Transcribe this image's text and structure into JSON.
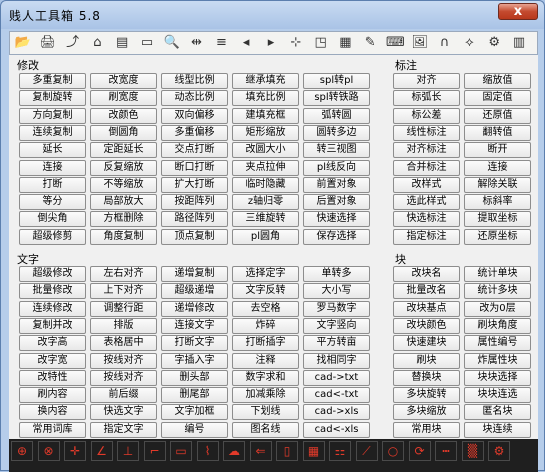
{
  "window": {
    "title": "贱人工具箱 5.8",
    "close_symbol": "x"
  },
  "toolbar": {
    "icons": [
      "folder-open-icon",
      "print-icon",
      "export-icon",
      "home-icon",
      "printer-icon",
      "window-icon",
      "zoom-icon",
      "dimension-icon",
      "layer-stack-icon",
      "arrow-left-icon",
      "arrow-right-icon",
      "move-icon",
      "frame-icon",
      "color-grid-icon",
      "edit-icon",
      "keyboard-icon",
      "image-icon",
      "magnet-icon",
      "snap-icon",
      "gears-icon",
      "calculator-icon"
    ],
    "glyphs": [
      "📂",
      "🖨",
      "⤴",
      "⌂",
      "▤",
      "▭",
      "🔍",
      "⇹",
      "≡",
      "◂",
      "▸",
      "⊹",
      "◳",
      "▦",
      "✎",
      "⌨",
      "🖼",
      "∩",
      "⟡",
      "⚙",
      "▥"
    ]
  },
  "sections": {
    "modify": "修改",
    "annotate": "标注",
    "text": "文字",
    "block": "块"
  },
  "modify_buttons": [
    [
      "多重复制",
      "改宽度",
      "线型比例",
      "继承填充",
      "spl转pl"
    ],
    [
      "复制旋转",
      "刷宽度",
      "动态比例",
      "填充比例",
      "spl转铁路"
    ],
    [
      "方向复制",
      "改颜色",
      "双向偏移",
      "建填充框",
      "弧转圆"
    ],
    [
      "连续复制",
      "倒圆角",
      "多重偏移",
      "矩形缩放",
      "圆转多边"
    ],
    [
      "延长",
      "定距延长",
      "交点打断",
      "改圆大小",
      "转三视图"
    ],
    [
      "连接",
      "反复缩放",
      "断口打断",
      "夹点拉伸",
      "pl线反向"
    ],
    [
      "打断",
      "不等缩放",
      "扩大打断",
      "临时隐藏",
      "前置对象"
    ],
    [
      "等分",
      "局部放大",
      "按距阵列",
      "z轴归零",
      "后置对象"
    ],
    [
      "倒尖角",
      "方框删除",
      "路径阵列",
      "三维旋转",
      "快速选择"
    ],
    [
      "超级修剪",
      "角度复制",
      "顶点复制",
      "pl圆角",
      "保存选择"
    ]
  ],
  "annotate_buttons": [
    [
      "对齐",
      "缩放值"
    ],
    [
      "标弧长",
      "固定值"
    ],
    [
      "标公差",
      "还原值"
    ],
    [
      "线性标注",
      "翻转值"
    ],
    [
      "对齐标注",
      "断开"
    ],
    [
      "合并标注",
      "连接"
    ],
    [
      "改样式",
      "解除关联"
    ],
    [
      "选此样式",
      "标斜率"
    ],
    [
      "快选标注",
      "提取坐标"
    ],
    [
      "指定标注",
      "还原坐标"
    ]
  ],
  "text_buttons": [
    [
      "超级修改",
      "左右对齐",
      "递增复制",
      "选择定字",
      "单转多"
    ],
    [
      "批量修改",
      "上下对齐",
      "超级递增",
      "文字反转",
      "大小写"
    ],
    [
      "连续修改",
      "调整行距",
      "递增修改",
      "去空格",
      "罗马数字"
    ],
    [
      "复制并改",
      "排版",
      "连接文字",
      "炸碎",
      "文字竖向"
    ],
    [
      "改字高",
      "表格居中",
      "打断文字",
      "打断插字",
      "平方转亩"
    ],
    [
      "改字宽",
      "按线对齐",
      "字插入字",
      "注释",
      "找相同字"
    ],
    [
      "改特性",
      "按线对齐",
      "删头部",
      "数字求和",
      "cad->txt"
    ],
    [
      "刷内容",
      "前后缀",
      "删尾部",
      "加减乘除",
      "cad<-txt"
    ],
    [
      "换内容",
      "快选文字",
      "文字加框",
      "下划线",
      "cad->xls"
    ],
    [
      "常用词库",
      "指定文字",
      "编号",
      "图名线",
      "cad<-xls"
    ]
  ],
  "block_buttons": [
    [
      "改块名",
      "统计单块"
    ],
    [
      "批量改名",
      "统计多块"
    ],
    [
      "改块基点",
      "改为0层"
    ],
    [
      "改块颜色",
      "刷块角度"
    ],
    [
      "快速建块",
      "属性编号"
    ],
    [
      "刷块",
      "炸属性块"
    ],
    [
      "替换块",
      "块块选择"
    ],
    [
      "多块旋转",
      "块块连选"
    ],
    [
      "多块缩放",
      "匿名块"
    ],
    [
      "常用块",
      "块连续"
    ]
  ],
  "bottom_bar": {
    "icons": [
      "crosshair-icon",
      "circle-cross-icon",
      "point-icon",
      "angle-icon",
      "axis-icon",
      "corner-icon",
      "rect-icon",
      "polyline-icon",
      "cloud-icon",
      "arrow-icon",
      "frame-icon",
      "table-icon",
      "stairs-icon",
      "diagonal-icon",
      "circle-icon",
      "spiral-icon",
      "dashed-line-icon",
      "gradient-icon",
      "settings-icon"
    ],
    "glyphs": [
      "⊕",
      "⊗",
      "✛",
      "∠",
      "⊥",
      "⌐",
      "▭",
      "⌇",
      "☁",
      "⇐",
      "▯",
      "▦",
      "⚏",
      "⟋",
      "○",
      "⟳",
      "┅",
      "▒",
      "⚙"
    ]
  },
  "colors": {
    "title_bg": "#c9dbf2",
    "close_button": "#c44a2f",
    "client_bg": "#f0f0f0",
    "bottom_bar": "#1f1f1f"
  }
}
